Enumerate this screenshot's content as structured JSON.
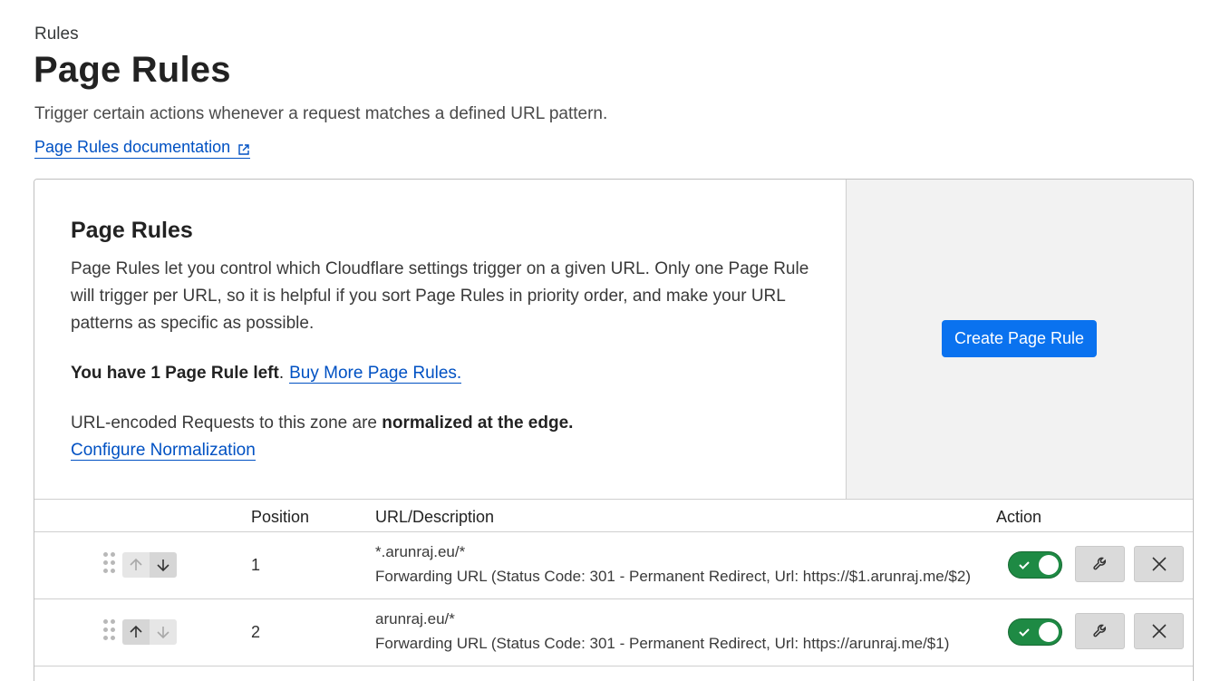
{
  "breadcrumb": "Rules",
  "page": {
    "title": "Page Rules",
    "subtitle": "Trigger certain actions whenever a request matches a defined URL pattern.",
    "doc_link": "Page Rules documentation"
  },
  "card": {
    "heading": "Page Rules",
    "description": "Page Rules let you control which Cloudflare settings trigger on a given URL. Only one Page Rule will trigger per URL, so it is helpful if you sort Page Rules in priority order, and make your URL patterns as specific as possible.",
    "limit_bold": "You have 1 Page Rule left",
    "limit_dot": ".",
    "buy_more": "Buy More Page Rules.",
    "norm_text": "URL-encoded Requests to this zone are ",
    "norm_bold": "normalized at the edge.",
    "norm_link": "Configure Normalization",
    "create_button": "Create Page Rule"
  },
  "table": {
    "headers": {
      "position": "Position",
      "url": "URL/Description",
      "action": "Action"
    },
    "rows": [
      {
        "position": "1",
        "url": "*.arunraj.eu/*",
        "description": "Forwarding URL (Status Code: 301 - Permanent Redirect, Url: https://$1.arunraj.me/$2)",
        "enabled": true
      },
      {
        "position": "2",
        "url": "arunraj.eu/*",
        "description": "Forwarding URL (Status Code: 301 - Permanent Redirect, Url: https://arunraj.me/$1)",
        "enabled": true
      }
    ]
  },
  "icons": {
    "external_link": "external-link-icon",
    "drag": "drag-handle-icon",
    "up": "arrow-up-icon",
    "down": "arrow-down-icon",
    "edit": "wrench-icon",
    "delete": "close-icon",
    "toggle_check": "check-icon"
  },
  "colors": {
    "link": "#0051c3",
    "primary_button": "#0a72ef",
    "toggle_on": "#1e8a44"
  }
}
